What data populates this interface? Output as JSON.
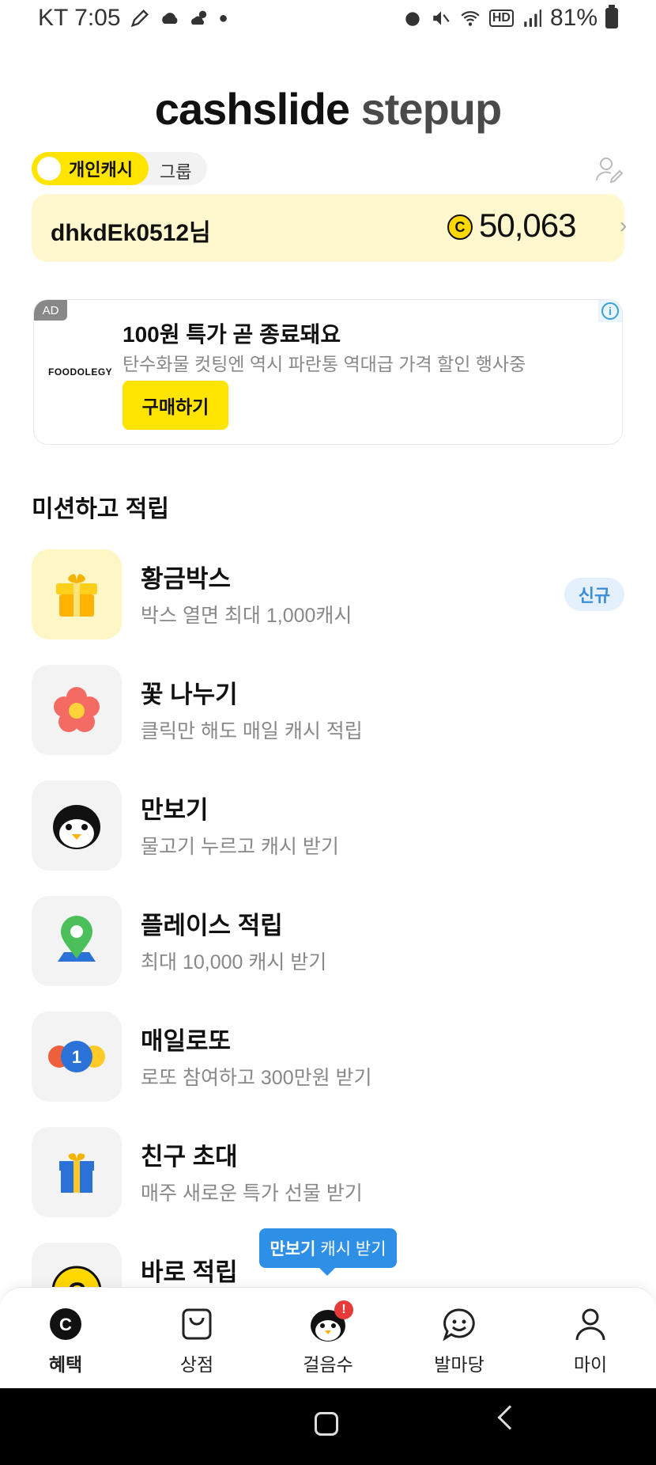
{
  "status_bar": {
    "carrier_time": "KT 7:05",
    "battery": "81%",
    "left_icons": [
      "pencil-icon",
      "cloud-icon",
      "weather-icon",
      "dot-icon"
    ],
    "right_icons": [
      "alarm-icon",
      "mute-icon",
      "wifi-icon",
      "hd-icon",
      "signal-icon",
      "battery-icon"
    ]
  },
  "header": {
    "brand_main": "cashslide",
    "brand_sub": "stepup"
  },
  "mode_toggle": {
    "personal_label": "개인캐시",
    "group_label": "그룹",
    "selected": "personal"
  },
  "user_card": {
    "username": "dhkdEk0512님",
    "coin_symbol": "C",
    "balance": "50,063"
  },
  "ad": {
    "badge": "AD",
    "advertiser": "FOODOLEGY",
    "title": "100원 특가 곧 종료돼요",
    "subtitle": "탄수화물 컷팅엔 역시 파란통 역대급 가격 할인 행사중",
    "cta": "구매하기"
  },
  "missions_section": {
    "title": "미션하고 적립",
    "items": [
      {
        "title": "황금박스",
        "desc": "박스 열면 최대 1,000캐시",
        "badge": "신규",
        "icon": "gift-box-icon"
      },
      {
        "title": "꽃 나누기",
        "desc": "클릭만 해도 매일 캐시 적립",
        "icon": "flower-icon"
      },
      {
        "title": "만보기",
        "desc": "물고기 누르고 캐시 받기",
        "icon": "penguin-icon"
      },
      {
        "title": "플레이스 적립",
        "desc": "최대 10,000 캐시 받기",
        "icon": "map-pin-icon"
      },
      {
        "title": "매일로또",
        "desc": "로또 참여하고 300만원 받기",
        "icon": "lotto-ball-icon"
      },
      {
        "title": "친구 초대",
        "desc": "매주 새로운 특가 선물 받기",
        "icon": "present-icon"
      },
      {
        "title": "바로 적립",
        "icon": "coin-icon"
      }
    ]
  },
  "tooltip": {
    "bold": "만보기",
    "text": "캐시 받기"
  },
  "bottom_nav": {
    "items": [
      {
        "label": "혜택",
        "icon": "coin-c-icon",
        "active": true
      },
      {
        "label": "상점",
        "icon": "shopping-bag-icon"
      },
      {
        "label": "걸음수",
        "icon": "penguin-icon",
        "alert": "!"
      },
      {
        "label": "발마당",
        "icon": "chat-smile-icon"
      },
      {
        "label": "마이",
        "icon": "person-icon"
      }
    ]
  },
  "colors": {
    "brand_yellow": "#ffe400",
    "card_yellow": "#fff8cf",
    "tooltip_blue": "#2e8fe6",
    "badge_blue_bg": "#e4f0fb",
    "badge_blue_text": "#3b8ed6"
  }
}
